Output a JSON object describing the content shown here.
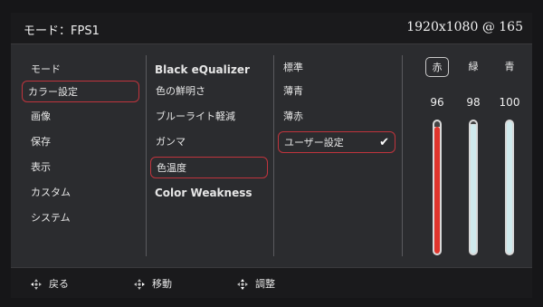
{
  "header": {
    "mode": "モード：FPS1",
    "resolution": "1920x1080 @ 165"
  },
  "menu1": [
    "モード",
    "カラー設定",
    "画像",
    "保存",
    "表示",
    "カスタム",
    "システム"
  ],
  "menu2": [
    "Black eQualizer",
    "色の鮮明さ",
    "ブルーライト軽減",
    "ガンマ",
    "色温度",
    "Color Weakness"
  ],
  "menu3": [
    "標準",
    "薄青",
    "薄赤",
    "ユーザー設定"
  ],
  "check_glyph": "✔",
  "rgb": {
    "labels": [
      "赤",
      "緑",
      "青"
    ],
    "values": [
      "96",
      "98",
      "100"
    ],
    "levels": [
      0.96,
      0.98,
      1.0
    ],
    "colors": [
      "#e0342c",
      "#cfe9ec",
      "#cfe9ec"
    ]
  },
  "footer": {
    "back": "戻る",
    "move": "移動",
    "adjust": "調整"
  }
}
